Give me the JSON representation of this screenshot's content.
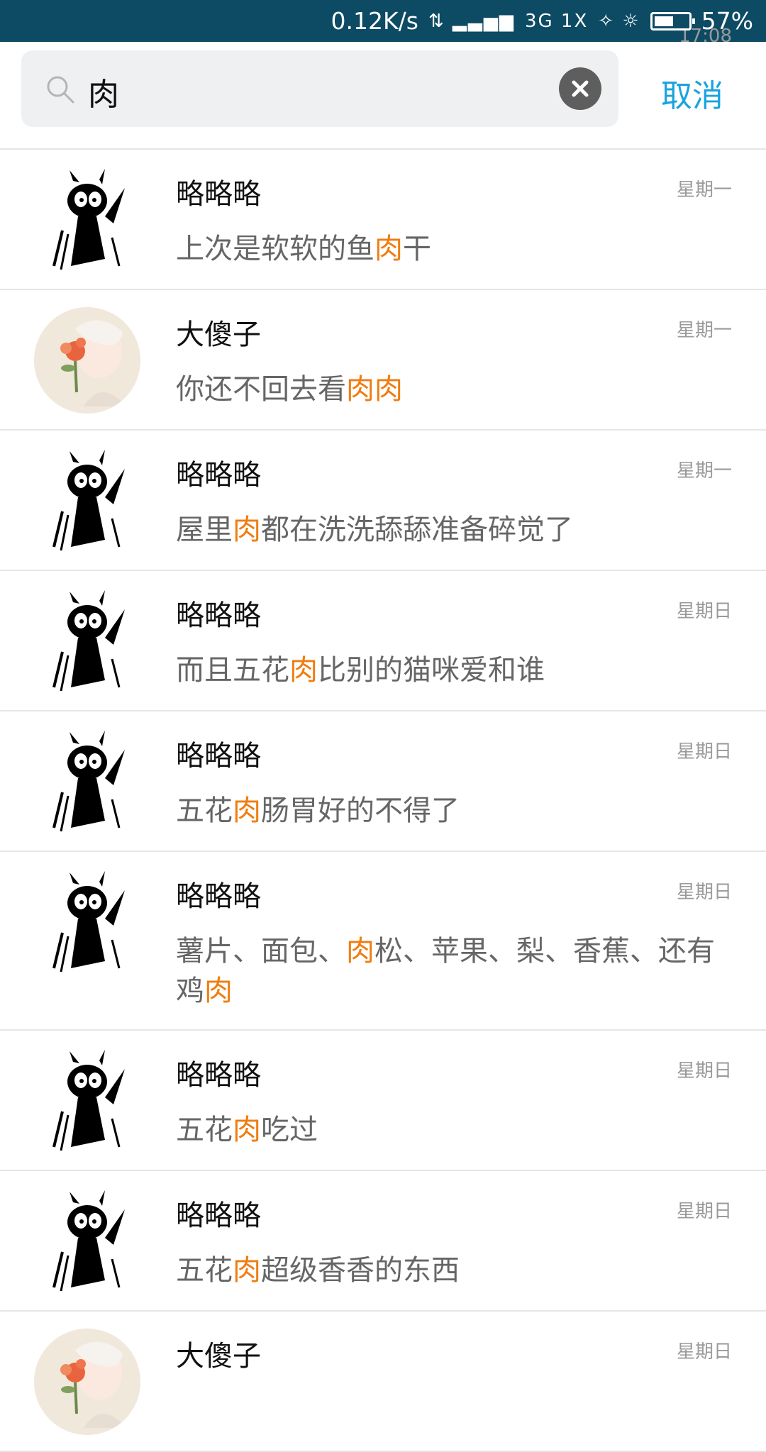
{
  "status_bar": {
    "time": "17:08",
    "speed": "0.12K/s",
    "network": "3G 1X",
    "battery": "57%",
    "battery_level": 0.57
  },
  "search": {
    "query": "肉",
    "cancel_label": "取消"
  },
  "results": [
    {
      "name": "略略略",
      "time": "星期一",
      "pre": "上次是软软的鱼",
      "hl": "肉",
      "post": "干",
      "avatar": "cat"
    },
    {
      "name": "大傻子",
      "time": "星期一",
      "pre": " 你还不回去看",
      "hl": "肉肉",
      "post": "",
      "avatar": "flower"
    },
    {
      "name": "略略略",
      "time": "星期一",
      "pre": "屋里",
      "hl": "肉",
      "post": "都在洗洗舔舔准备碎觉了",
      "avatar": "cat"
    },
    {
      "name": "略略略",
      "time": "星期日",
      "pre": "而且五花",
      "hl": "肉",
      "post": "比别的猫咪爱和谁",
      "avatar": "cat"
    },
    {
      "name": "略略略",
      "time": "星期日",
      "pre": "五花",
      "hl": "肉",
      "post": "肠胃好的不得了",
      "avatar": "cat"
    },
    {
      "name": "略略略",
      "time": "星期日",
      "pre": "薯片、面包、",
      "hl": "肉",
      "post": "松、苹果、梨、香蕉、还有鸡",
      "hl2": "肉",
      "avatar": "cat"
    },
    {
      "name": "略略略",
      "time": "星期日",
      "pre": "五花",
      "hl": "肉",
      "post": "吃过",
      "avatar": "cat"
    },
    {
      "name": "略略略",
      "time": "星期日",
      "pre": "五花",
      "hl": "肉",
      "post": "超级香香的东西",
      "avatar": "cat"
    },
    {
      "name": "大傻子",
      "time": "星期日",
      "pre": "",
      "hl": "",
      "post": "",
      "avatar": "flower"
    }
  ]
}
